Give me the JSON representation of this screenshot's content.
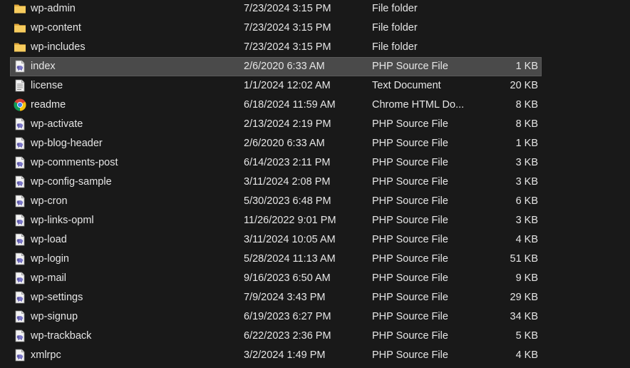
{
  "files": [
    {
      "name": "wp-admin",
      "date": "7/23/2024 3:15 PM",
      "type": "File folder",
      "size": "",
      "icon": "folder-icon"
    },
    {
      "name": "wp-content",
      "date": "7/23/2024 3:15 PM",
      "type": "File folder",
      "size": "",
      "icon": "folder-icon"
    },
    {
      "name": "wp-includes",
      "date": "7/23/2024 3:15 PM",
      "type": "File folder",
      "size": "",
      "icon": "folder-icon"
    },
    {
      "name": "index",
      "date": "2/6/2020 6:33 AM",
      "type": "PHP Source File",
      "size": "1 KB",
      "icon": "php-file-icon",
      "selected": true
    },
    {
      "name": "license",
      "date": "1/1/2024 12:02 AM",
      "type": "Text Document",
      "size": "20 KB",
      "icon": "text-file-icon"
    },
    {
      "name": "readme",
      "date": "6/18/2024 11:59 AM",
      "type": "Chrome HTML Do...",
      "size": "8 KB",
      "icon": "chrome-icon"
    },
    {
      "name": "wp-activate",
      "date": "2/13/2024 2:19 PM",
      "type": "PHP Source File",
      "size": "8 KB",
      "icon": "php-file-icon"
    },
    {
      "name": "wp-blog-header",
      "date": "2/6/2020 6:33 AM",
      "type": "PHP Source File",
      "size": "1 KB",
      "icon": "php-file-icon"
    },
    {
      "name": "wp-comments-post",
      "date": "6/14/2023 2:11 PM",
      "type": "PHP Source File",
      "size": "3 KB",
      "icon": "php-file-icon"
    },
    {
      "name": "wp-config-sample",
      "date": "3/11/2024 2:08 PM",
      "type": "PHP Source File",
      "size": "3 KB",
      "icon": "php-file-icon"
    },
    {
      "name": "wp-cron",
      "date": "5/30/2023 6:48 PM",
      "type": "PHP Source File",
      "size": "6 KB",
      "icon": "php-file-icon"
    },
    {
      "name": "wp-links-opml",
      "date": "11/26/2022 9:01 PM",
      "type": "PHP Source File",
      "size": "3 KB",
      "icon": "php-file-icon"
    },
    {
      "name": "wp-load",
      "date": "3/11/2024 10:05 AM",
      "type": "PHP Source File",
      "size": "4 KB",
      "icon": "php-file-icon"
    },
    {
      "name": "wp-login",
      "date": "5/28/2024 11:13 AM",
      "type": "PHP Source File",
      "size": "51 KB",
      "icon": "php-file-icon"
    },
    {
      "name": "wp-mail",
      "date": "9/16/2023 6:50 AM",
      "type": "PHP Source File",
      "size": "9 KB",
      "icon": "php-file-icon"
    },
    {
      "name": "wp-settings",
      "date": "7/9/2024 3:43 PM",
      "type": "PHP Source File",
      "size": "29 KB",
      "icon": "php-file-icon"
    },
    {
      "name": "wp-signup",
      "date": "6/19/2023 6:27 PM",
      "type": "PHP Source File",
      "size": "34 KB",
      "icon": "php-file-icon"
    },
    {
      "name": "wp-trackback",
      "date": "6/22/2023 2:36 PM",
      "type": "PHP Source File",
      "size": "5 KB",
      "icon": "php-file-icon"
    },
    {
      "name": "xmlrpc",
      "date": "3/2/2024 1:49 PM",
      "type": "PHP Source File",
      "size": "4 KB",
      "icon": "php-file-icon"
    }
  ],
  "colors": {
    "background": "#191919",
    "text": "#e6e6e6",
    "selected_row": "#4a4a4a",
    "folder": "#f4c55b",
    "php_elephant": "#7c78c8"
  }
}
